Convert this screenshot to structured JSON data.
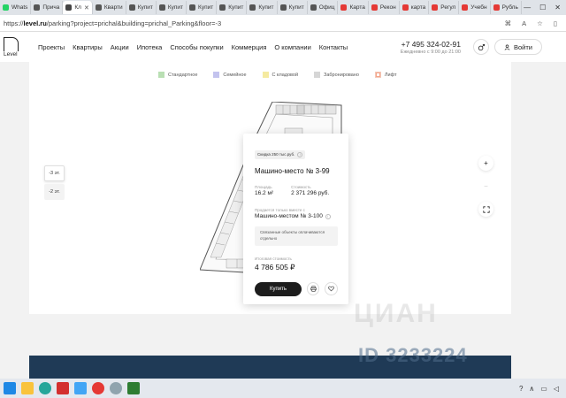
{
  "browser": {
    "tabs": [
      {
        "label": "Whats",
        "color": "#25d366"
      },
      {
        "label": "Прича",
        "color": "#555555"
      },
      {
        "label": "Кл",
        "color": "#444444",
        "active": true
      },
      {
        "label": "Кварти",
        "color": "#555555"
      },
      {
        "label": "Купит",
        "color": "#555555"
      },
      {
        "label": "Купит",
        "color": "#555555"
      },
      {
        "label": "Купит",
        "color": "#555555"
      },
      {
        "label": "Купит",
        "color": "#555555"
      },
      {
        "label": "Купит",
        "color": "#555555"
      },
      {
        "label": "Купит",
        "color": "#555555"
      },
      {
        "label": "Офиц",
        "color": "#555555"
      },
      {
        "label": "Карта",
        "color": "#e53935"
      },
      {
        "label": "Рекон",
        "color": "#e53935"
      },
      {
        "label": "карта",
        "color": "#e53935"
      },
      {
        "label": "Регул",
        "color": "#e53935"
      },
      {
        "label": "Учебн",
        "color": "#e53935"
      },
      {
        "label": "Рубль",
        "color": "#e53935"
      }
    ],
    "url_prefix": "https://",
    "url_domain": "level.ru",
    "url_rest": "/parking?project=prichal&building=prichal_Parking&floor=-3"
  },
  "header": {
    "logo_text": "Level",
    "nav": [
      "Проекты",
      "Квартиры",
      "Акции",
      "Ипотека",
      "Способы покупки",
      "Коммерция",
      "О компании",
      "Контакты"
    ],
    "phone": "+7 495 324-02-91",
    "hours": "Ежедневно с 9:00 до 21:00",
    "login_label": "Войти"
  },
  "legend": [
    {
      "label": "Стандартное",
      "color": "#b9dfb3"
    },
    {
      "label": "Семейное",
      "color": "#c3c3ee"
    },
    {
      "label": "С кладовой",
      "color": "#f5eaa0"
    },
    {
      "label": "Забронировано",
      "color": "#d6d6d6"
    },
    {
      "label": "Лифт",
      "color": "#f3c9b9"
    }
  ],
  "floors": [
    "-3 эт.",
    "-2 эт."
  ],
  "zoom": {
    "in": "+",
    "out": "−",
    "fit": "⛶"
  },
  "card": {
    "discount": "Скидка 250 тыс.руб.",
    "title": "Машино-место № 3-99",
    "area_label": "Площадь",
    "area_value": "16.2 м²",
    "price_label": "Стоимость",
    "price_value": "2 371 296 руб.",
    "sold_label": "Продается только вместе с",
    "sold_value": "Машино-местом № 3-100",
    "note": "Связанные объекты оплачиваются отдельно",
    "total_label": "Итоговая стоимость",
    "total_value": "4 786 505 ₽",
    "buy_label": "Купить"
  },
  "watermark": "ЦИАН",
  "banner_watermark": "ID 3233224"
}
